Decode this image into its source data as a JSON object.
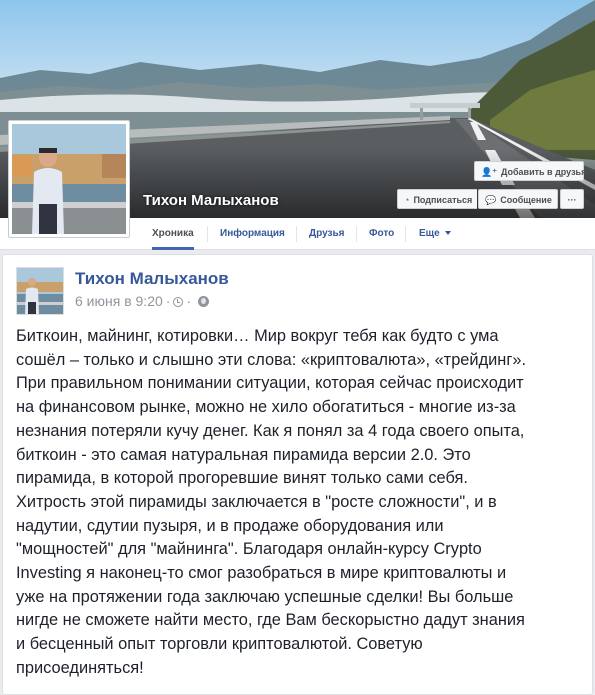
{
  "profile": {
    "name": "Тихон Малыханов"
  },
  "actions": {
    "add_friend": "Добавить в друзья",
    "follow": "Подписаться",
    "message": "Сообщение",
    "more": "···"
  },
  "nav": {
    "tabs": [
      {
        "label": "Хроника",
        "active": true
      },
      {
        "label": "Информация"
      },
      {
        "label": "Друзья"
      },
      {
        "label": "Фото"
      },
      {
        "label": "Еще"
      }
    ]
  },
  "post": {
    "author": "Тихон Малыханов",
    "date": "6 июня в 9:20",
    "text": "Биткоин, майнинг, котировки… Мир вокруг тебя как будто с ума\nсошёл – только и слышно эти слова: «криптовалюта», «трейдинг».\nПри правильном понимании ситуации, которая сейчас происходит\nна финансовом рынке, можно не хило обогатиться - многие из-за\nнезнания потеряли кучу денег. Как я понял за 4 года своего опыта,\nбиткоин - это самая натуральная пирамида версии 2.0. Это\nпирамида, в которой прогоревшие винят только сами себя.\nХитрость этой пирамиды заключается в \"росте сложности\", и в\nнадутии, сдутии пузыря, и в продаже оборудования или\n\"мощностей\" для \"майнинга\". Благодаря онлайн-курсу Crypto\nInvesting я наконец-то смог разобраться в мире криптовалюты и\nуже на протяжении года заключаю успешные сделки! Вы больше\nнигде не сможете найти место, где Вам бескорыстно дадут знания\nи бесценный опыт торговли криптовалютой. Советую\nприсоединяться!"
  },
  "icons": {
    "add_friend": "add-friend-icon",
    "follow": "rss-icon",
    "message": "messenger-icon",
    "privacy": "globe-icon",
    "time": "clock-icon"
  },
  "colors": {
    "link": "#365899",
    "accent": "#4267b2",
    "background": "#e9ebee",
    "meta": "#90949c"
  }
}
